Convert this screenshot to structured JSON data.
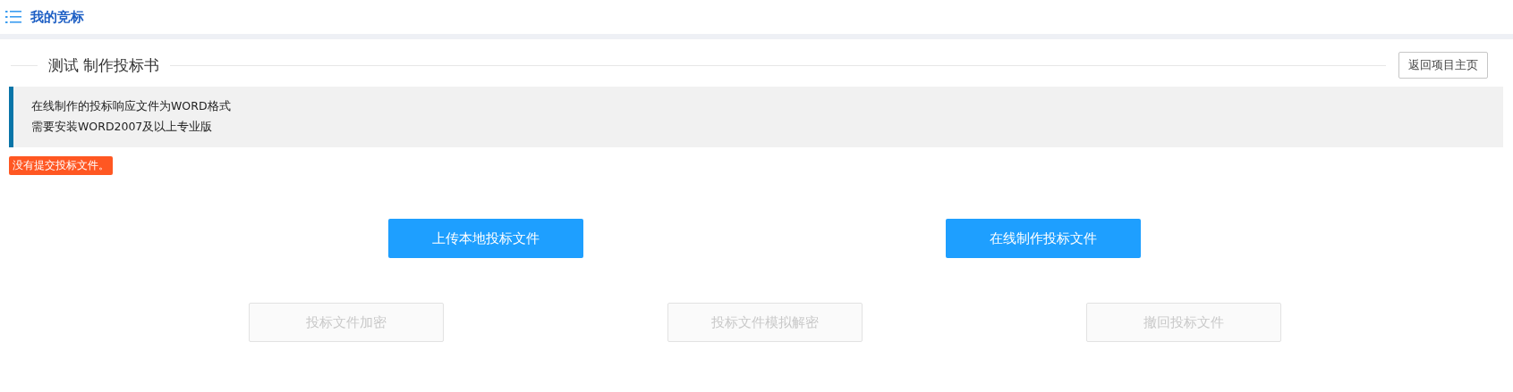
{
  "header": {
    "title": "我的竞标"
  },
  "section": {
    "title": "测试 制作投标书",
    "back_button": "返回项目主页"
  },
  "notice": {
    "lines": [
      "在线制作的投标响应文件为WORD格式",
      "需要安装WORD2007及以上专业版"
    ]
  },
  "status_badge": "没有提交投标文件。",
  "primary_actions": [
    {
      "label": "上传本地投标文件",
      "disabled": false
    },
    {
      "label": "在线制作投标文件",
      "disabled": false
    }
  ],
  "secondary_actions": [
    {
      "label": "投标文件加密",
      "disabled": true
    },
    {
      "label": "投标文件模拟解密",
      "disabled": true
    },
    {
      "label": "撤回投标文件",
      "disabled": true
    }
  ]
}
